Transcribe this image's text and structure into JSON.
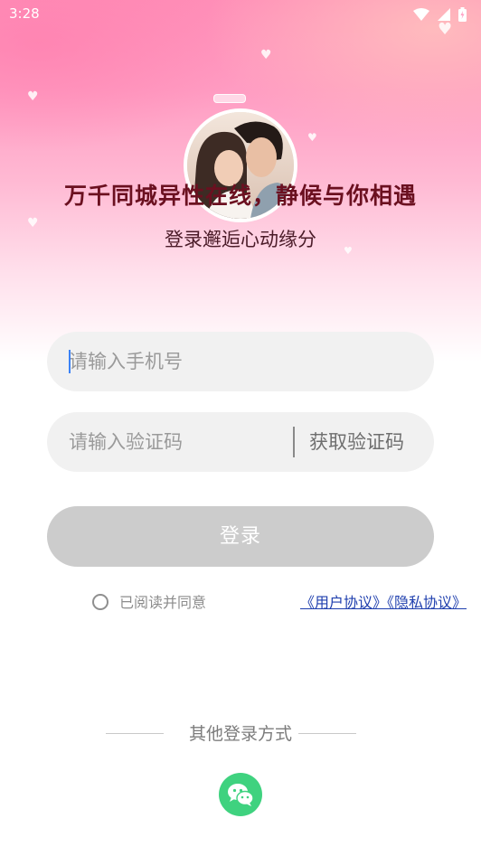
{
  "status_bar": {
    "time": "3:28"
  },
  "hero": {
    "headline": "万千同城异性在线，静候与你相遇",
    "subheadline": "登录邂逅心动缘分"
  },
  "form": {
    "phone_placeholder": "请输入手机号",
    "code_placeholder": "请输入验证码",
    "get_code_label": "获取验证码",
    "login_label": "登录"
  },
  "agreement": {
    "prefix": "已阅读并同意",
    "links": "《用户协议》《隐私协议》",
    "checked": false
  },
  "other_login": {
    "label": "其他登录方式",
    "method_icon": "wechat-icon"
  },
  "colors": {
    "headline": "#6b1020",
    "login_button_disabled": "#cccccc",
    "link": "#1f3fae",
    "wechat": "#3fd27f"
  }
}
